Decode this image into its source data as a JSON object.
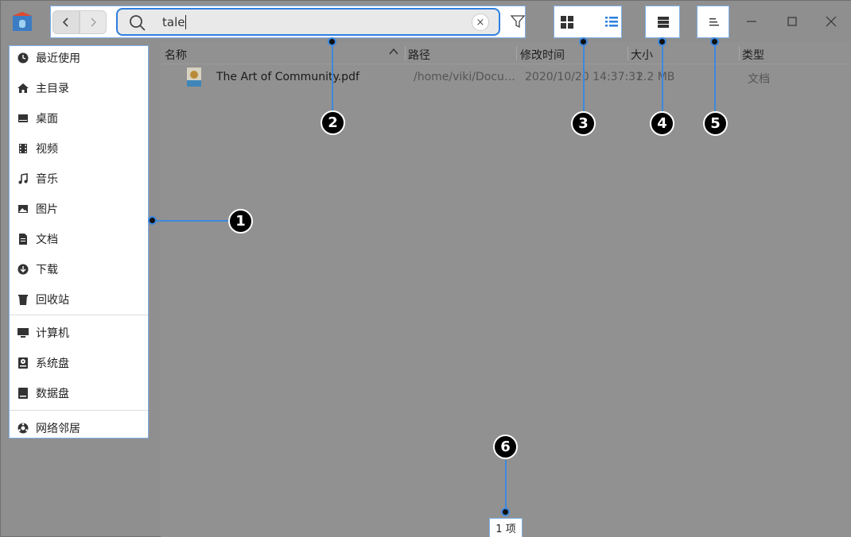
{
  "search": {
    "query": "tale",
    "clear_symbol": "×"
  },
  "sidebar": {
    "items": [
      {
        "label": "最近使用",
        "icon": "clock-icon"
      },
      {
        "label": "主目录",
        "icon": "home-icon"
      },
      {
        "label": "桌面",
        "icon": "desktop-icon"
      },
      {
        "label": "视频",
        "icon": "video-icon"
      },
      {
        "label": "音乐",
        "icon": "music-icon"
      },
      {
        "label": "图片",
        "icon": "picture-icon"
      },
      {
        "label": "文档",
        "icon": "document-icon"
      },
      {
        "label": "下载",
        "icon": "download-icon"
      },
      {
        "label": "回收站",
        "icon": "trash-icon"
      },
      {
        "label": "计算机",
        "icon": "computer-icon"
      },
      {
        "label": "系统盘",
        "icon": "system-disk-icon"
      },
      {
        "label": "数据盘",
        "icon": "data-disk-icon"
      },
      {
        "label": "网络邻居",
        "icon": "network-icon"
      }
    ]
  },
  "columns": {
    "name": "名称",
    "path": "路径",
    "modified": "修改时间",
    "size": "大小",
    "type": "类型"
  },
  "files": [
    {
      "name": "The Art of Community.pdf",
      "path": "/home/viki/Docu…",
      "modified": "2020/10/20 14:37:31",
      "size": "2.2 MB",
      "type": "文档"
    }
  ],
  "status": {
    "count": "1 项"
  },
  "callouts": [
    "1",
    "2",
    "3",
    "4",
    "5",
    "6"
  ],
  "colors": {
    "accent": "#2d7fe0",
    "callout_line": "#3d88dd",
    "overlay": "#8f8f8f"
  }
}
